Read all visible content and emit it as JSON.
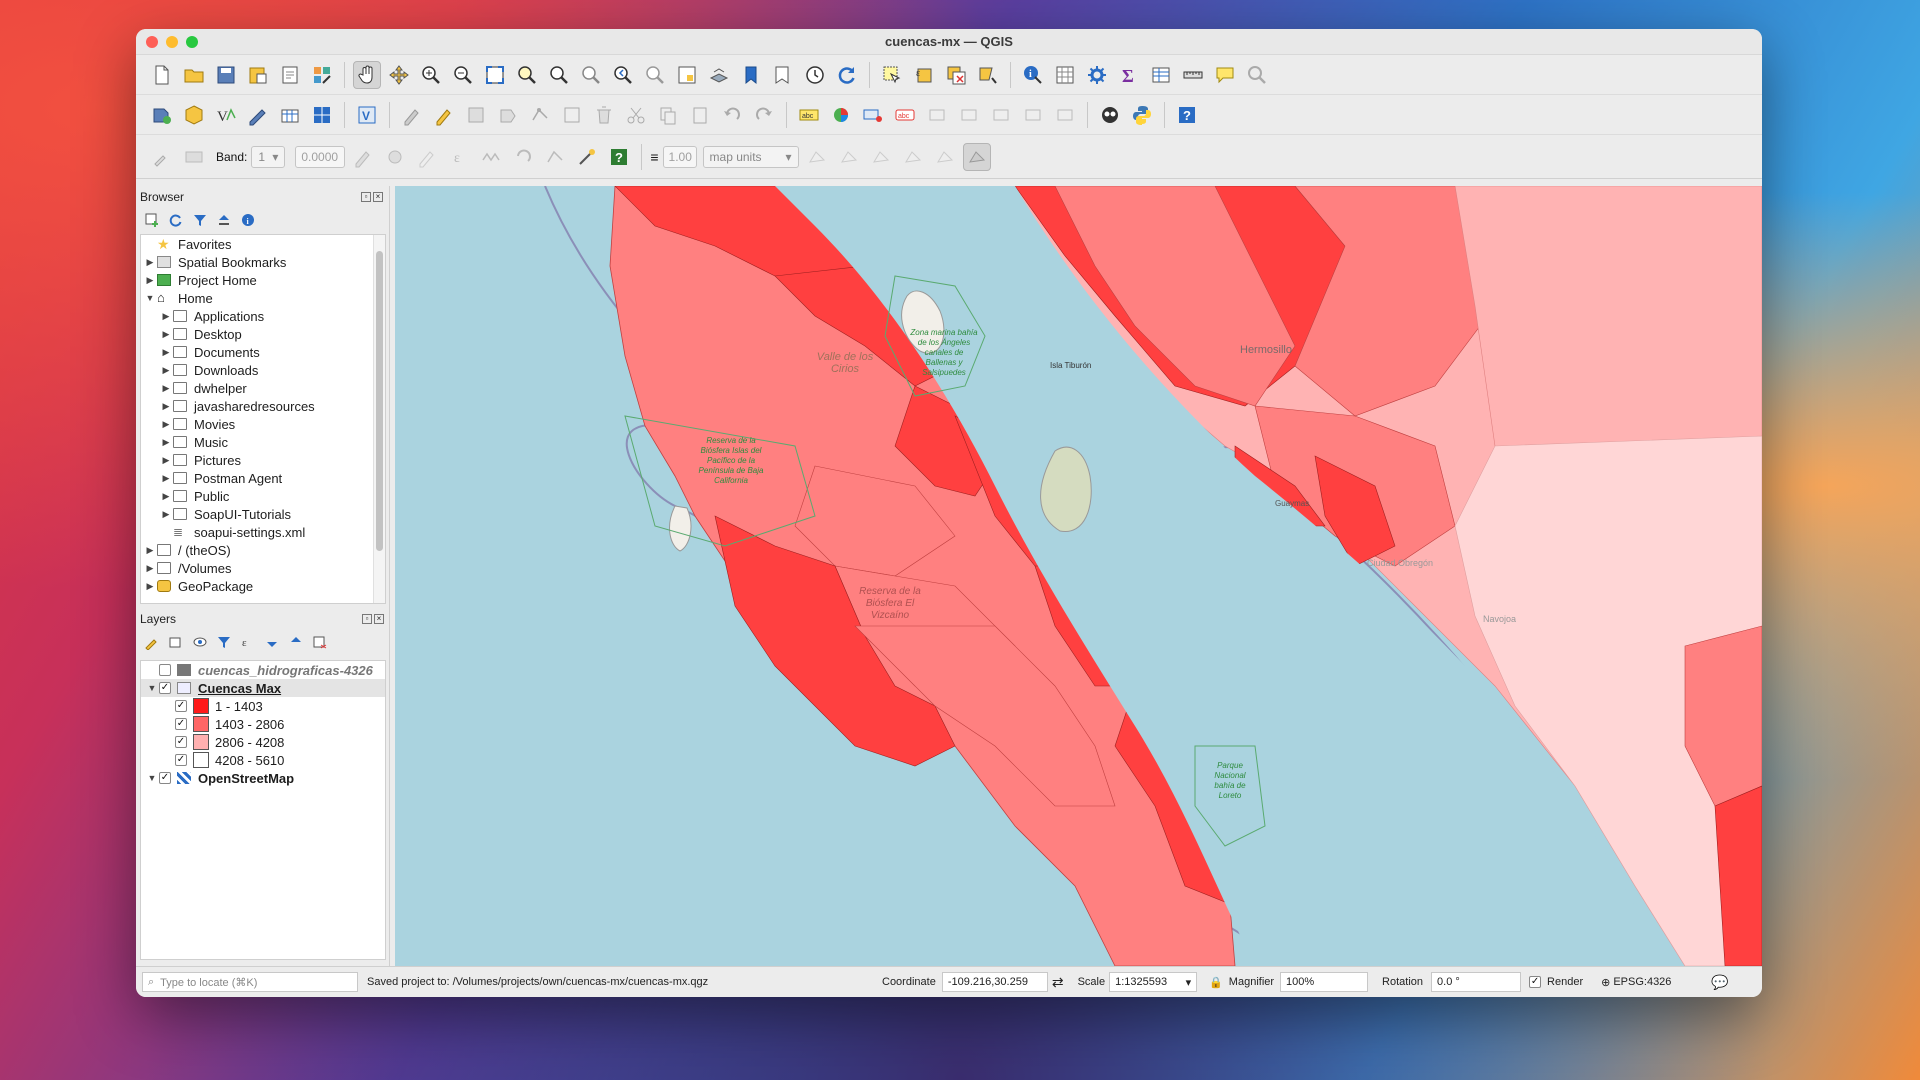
{
  "window": {
    "title": "cuencas-mx — QGIS"
  },
  "toolbar3": {
    "band_label": "Band:",
    "band_value": "1",
    "band_input": "0.0000",
    "width_value": "1.00",
    "units_value": "map units"
  },
  "browser": {
    "title": "Browser",
    "items": [
      {
        "label": "Favorites",
        "icon": "star-icon",
        "level": 0,
        "arrow": ""
      },
      {
        "label": "Spatial Bookmarks",
        "icon": "bookmark-icon",
        "level": 0,
        "arrow": "▶"
      },
      {
        "label": "Project Home",
        "icon": "project-home-icon",
        "level": 0,
        "arrow": "▶"
      },
      {
        "label": "Home",
        "icon": "home-icon",
        "level": 0,
        "arrow": "▼"
      },
      {
        "label": "Applications",
        "icon": "folder-icon",
        "level": 1,
        "arrow": "▶"
      },
      {
        "label": "Desktop",
        "icon": "folder-icon",
        "level": 1,
        "arrow": "▶"
      },
      {
        "label": "Documents",
        "icon": "folder-icon",
        "level": 1,
        "arrow": "▶"
      },
      {
        "label": "Downloads",
        "icon": "folder-icon",
        "level": 1,
        "arrow": "▶"
      },
      {
        "label": "dwhelper",
        "icon": "folder-icon",
        "level": 1,
        "arrow": "▶"
      },
      {
        "label": "javasharedresources",
        "icon": "folder-icon",
        "level": 1,
        "arrow": "▶"
      },
      {
        "label": "Movies",
        "icon": "folder-icon",
        "level": 1,
        "arrow": "▶"
      },
      {
        "label": "Music",
        "icon": "folder-icon",
        "level": 1,
        "arrow": "▶"
      },
      {
        "label": "Pictures",
        "icon": "folder-icon",
        "level": 1,
        "arrow": "▶"
      },
      {
        "label": "Postman Agent",
        "icon": "folder-icon",
        "level": 1,
        "arrow": "▶"
      },
      {
        "label": "Public",
        "icon": "folder-icon",
        "level": 1,
        "arrow": "▶"
      },
      {
        "label": "SoapUI-Tutorials",
        "icon": "folder-icon",
        "level": 1,
        "arrow": "▶"
      },
      {
        "label": "soapui-settings.xml",
        "icon": "database-icon",
        "level": 1,
        "arrow": ""
      },
      {
        "label": "/ (theOS)",
        "icon": "folder-icon",
        "level": 0,
        "arrow": "▶"
      },
      {
        "label": "/Volumes",
        "icon": "folder-icon",
        "level": 0,
        "arrow": "▶"
      },
      {
        "label": "GeoPackage",
        "icon": "geopackage-icon",
        "level": 0,
        "arrow": "▶"
      }
    ]
  },
  "layers": {
    "title": "Layers",
    "rows": [
      {
        "label": "cuencas_hidrograficas-4326",
        "checked": "",
        "style": "italic-gray"
      },
      {
        "label": "Cuencas Max",
        "checked": "✓",
        "style": "bold-underline"
      },
      {
        "label": "1 - 1403",
        "checked": "✓",
        "color": "#ff1a1a"
      },
      {
        "label": "1403 - 2806",
        "checked": "✓",
        "color": "#ff6666"
      },
      {
        "label": "2806 - 4208",
        "checked": "✓",
        "color": "#ffb0b0"
      },
      {
        "label": "4208 - 5610",
        "checked": "✓",
        "color": "#ffffff"
      },
      {
        "label": "OpenStreetMap",
        "checked": "✓",
        "style": "bold"
      }
    ]
  },
  "map": {
    "labels": {
      "hermosillo": "Hermosillo",
      "isla_tiburon": "Isla Tiburón",
      "valle": "Valle de los Cirios",
      "zona_marina": "Zona marina bahía de los Ángeles canales de Ballenas y Salsipuedes",
      "reserva_islas": "Reserva de la Biósfera Islas del Pacífico de la Península de Baja California",
      "reserva_vizcaino": "Reserva de la Biósfera El Vizcaíno",
      "ciudad_obregon": "Ciudad Obregón",
      "navojoa": "Navojoa",
      "guaymas": "Guaymas",
      "parque_loreto": "Parque Nacional bahía de Loreto"
    },
    "colors": {
      "water": "#aad3df",
      "class1": "#ff4040",
      "class2": "#ff7f7f",
      "class3": "#ffb3b3",
      "class4": "#fff0f0",
      "land": "#f2efe9"
    }
  },
  "status": {
    "locate_placeholder": "Type to locate (⌘K)",
    "message": "Saved project to: /Volumes/projects/own/cuencas-mx/cuencas-mx.qgz",
    "coordinate_label": "Coordinate",
    "coordinate_value": "-109.216,30.259",
    "scale_label": "Scale",
    "scale_value": "1:1325593",
    "magnifier_label": "Magnifier",
    "magnifier_value": "100%",
    "rotation_label": "Rotation",
    "rotation_value": "0.0 °",
    "render_label": "Render",
    "crs_value": "EPSG:4326"
  }
}
